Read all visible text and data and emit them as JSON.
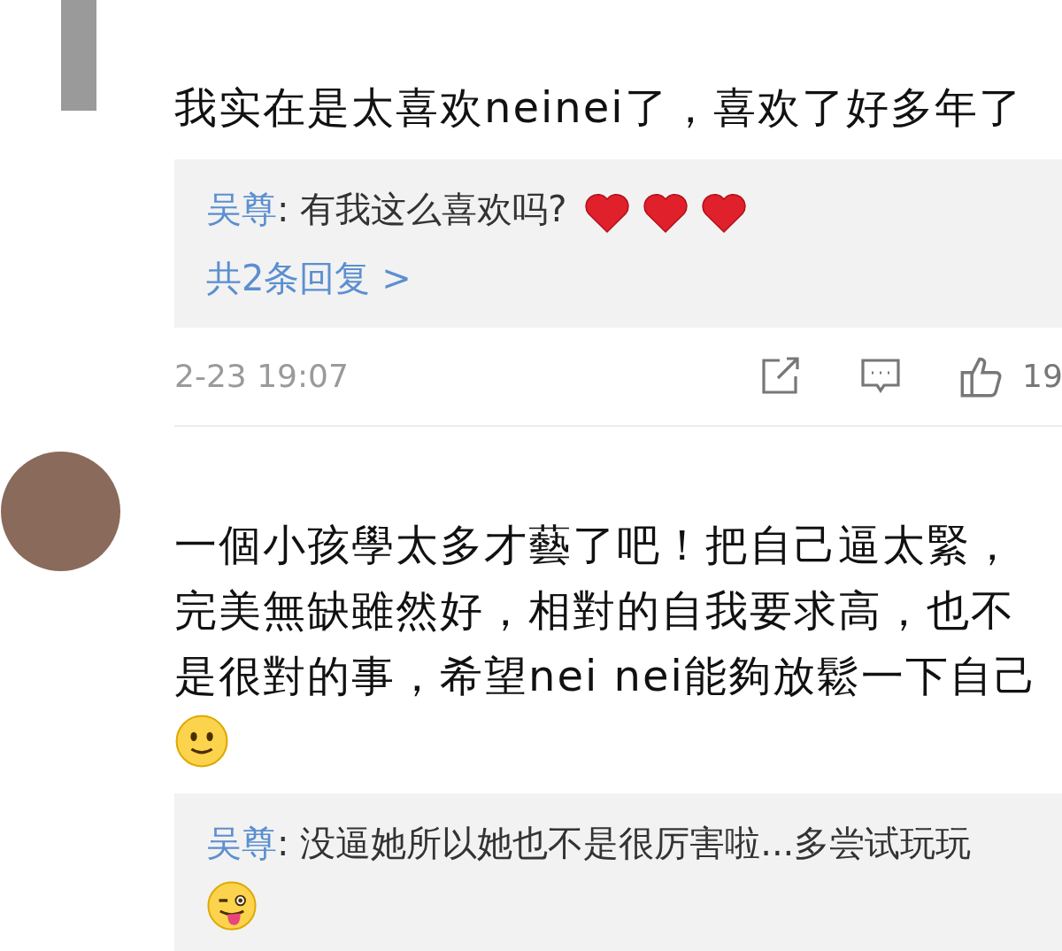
{
  "comments": [
    {
      "text": "我实在是太喜欢neinei了，喜欢了好多年了",
      "replies": [
        {
          "author": "吴尊",
          "text": ": 有我这么喜欢吗? ",
          "emoji": [
            {
              "kind": "heart"
            },
            {
              "kind": "heart"
            },
            {
              "kind": "heart"
            }
          ]
        }
      ],
      "more_replies": "共2条回复 >",
      "time": "2-23 19:07",
      "likes": "19"
    },
    {
      "text": "一個小孩學太多才藝了吧！把自己逼太緊，完美無缺雖然好，相對的自我要求高，也不是很對的事，希望nei nei能夠放鬆一下自己",
      "emoji": [
        {
          "kind": "smile"
        }
      ],
      "replies": [
        {
          "author": "吴尊",
          "text": ": 没逼她所以她也不是很厉害啦...多尝试玩玩",
          "emoji": [
            {
              "kind": "tongue"
            }
          ]
        }
      ]
    }
  ]
}
